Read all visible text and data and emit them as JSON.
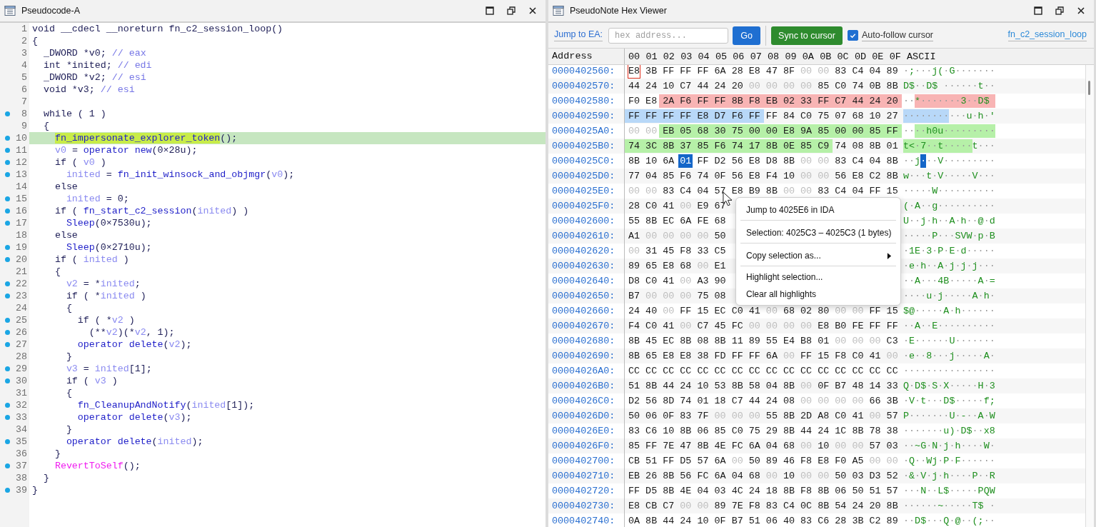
{
  "code_pane": {
    "title": "Pseudocode-A",
    "lines": [
      {
        "number": "1",
        "marked": false,
        "current": false,
        "tokens": [
          {
            "text": "void __cdecl __noreturn fn_c2_session_loop()",
            "kind": "p"
          }
        ]
      },
      {
        "number": "2",
        "marked": false,
        "current": false,
        "tokens": [
          {
            "text": "{",
            "kind": "p"
          }
        ]
      },
      {
        "number": "3",
        "marked": false,
        "current": false,
        "tokens": [
          {
            "text": "  _DWORD *v0; ",
            "kind": "p"
          },
          {
            "text": "// eax",
            "kind": "c"
          }
        ]
      },
      {
        "number": "4",
        "marked": false,
        "current": false,
        "tokens": [
          {
            "text": "  int *inited; ",
            "kind": "p"
          },
          {
            "text": "// edi",
            "kind": "c"
          }
        ]
      },
      {
        "number": "5",
        "marked": false,
        "current": false,
        "tokens": [
          {
            "text": "  _DWORD *v2; ",
            "kind": "p"
          },
          {
            "text": "// esi",
            "kind": "c"
          }
        ]
      },
      {
        "number": "6",
        "marked": false,
        "current": false,
        "tokens": [
          {
            "text": "  void *v3; ",
            "kind": "p"
          },
          {
            "text": "// esi",
            "kind": "c"
          }
        ]
      },
      {
        "number": "7",
        "marked": false,
        "current": false
      },
      {
        "number": "8",
        "marked": true,
        "current": false,
        "tokens": [
          {
            "text": "  while ( 1 )",
            "kind": "p"
          }
        ]
      },
      {
        "number": "9",
        "marked": false,
        "current": false,
        "tokens": [
          {
            "text": "  {",
            "kind": "p"
          }
        ]
      },
      {
        "number": "10",
        "marked": true,
        "current": true,
        "tokens": [
          {
            "text": "    fn_impersonate_explorer_token",
            "kind": "h"
          },
          {
            "text": "();",
            "kind": "p"
          }
        ]
      },
      {
        "number": "11",
        "marked": true,
        "current": false,
        "tokens": [
          {
            "text": "    v0",
            "kind": "v"
          },
          {
            "text": " = ",
            "kind": "p"
          },
          {
            "text": "operator new",
            "kind": "f"
          },
          {
            "text": "(0×28u);",
            "kind": "p"
          }
        ]
      },
      {
        "number": "12",
        "marked": true,
        "current": false,
        "tokens": [
          {
            "text": "    if ( ",
            "kind": "p"
          },
          {
            "text": "v0",
            "kind": "v"
          },
          {
            "text": " )",
            "kind": "p"
          }
        ]
      },
      {
        "number": "13",
        "marked": true,
        "current": false,
        "tokens": [
          {
            "text": "      inited",
            "kind": "v"
          },
          {
            "text": " = ",
            "kind": "p"
          },
          {
            "text": "fn_init_winsock_and_objmgr",
            "kind": "f"
          },
          {
            "text": "(",
            "kind": "p"
          },
          {
            "text": "v0",
            "kind": "v"
          },
          {
            "text": ");",
            "kind": "p"
          }
        ]
      },
      {
        "number": "14",
        "marked": false,
        "current": false,
        "tokens": [
          {
            "text": "    else",
            "kind": "p"
          }
        ]
      },
      {
        "number": "15",
        "marked": true,
        "current": false,
        "tokens": [
          {
            "text": "      inited",
            "kind": "v"
          },
          {
            "text": " = 0;",
            "kind": "p"
          }
        ]
      },
      {
        "number": "16",
        "marked": true,
        "current": false,
        "tokens": [
          {
            "text": "    if ( ",
            "kind": "p"
          },
          {
            "text": "fn_start_c2_session",
            "kind": "f"
          },
          {
            "text": "(",
            "kind": "p"
          },
          {
            "text": "inited",
            "kind": "v"
          },
          {
            "text": ") )",
            "kind": "p"
          }
        ]
      },
      {
        "number": "17",
        "marked": true,
        "current": false,
        "tokens": [
          {
            "text": "      Sleep",
            "kind": "f"
          },
          {
            "text": "(0×7530u);",
            "kind": "p"
          }
        ]
      },
      {
        "number": "18",
        "marked": false,
        "current": false,
        "tokens": [
          {
            "text": "    else",
            "kind": "p"
          }
        ]
      },
      {
        "number": "19",
        "marked": true,
        "current": false,
        "tokens": [
          {
            "text": "      Sleep",
            "kind": "f"
          },
          {
            "text": "(0×2710u);",
            "kind": "p"
          }
        ]
      },
      {
        "number": "20",
        "marked": true,
        "current": false,
        "tokens": [
          {
            "text": "    if ( ",
            "kind": "p"
          },
          {
            "text": "inited",
            "kind": "v"
          },
          {
            "text": " )",
            "kind": "p"
          }
        ]
      },
      {
        "number": "21",
        "marked": false,
        "current": false,
        "tokens": [
          {
            "text": "    {",
            "kind": "p"
          }
        ]
      },
      {
        "number": "22",
        "marked": true,
        "current": false,
        "tokens": [
          {
            "text": "      v2",
            "kind": "v"
          },
          {
            "text": " = *",
            "kind": "p"
          },
          {
            "text": "inited",
            "kind": "v"
          },
          {
            "text": ";",
            "kind": "p"
          }
        ]
      },
      {
        "number": "23",
        "marked": true,
        "current": false,
        "tokens": [
          {
            "text": "      if ( *",
            "kind": "p"
          },
          {
            "text": "inited",
            "kind": "v"
          },
          {
            "text": " )",
            "kind": "p"
          }
        ]
      },
      {
        "number": "24",
        "marked": false,
        "current": false,
        "tokens": [
          {
            "text": "      {",
            "kind": "p"
          }
        ]
      },
      {
        "number": "25",
        "marked": true,
        "current": false,
        "tokens": [
          {
            "text": "        if ( *",
            "kind": "p"
          },
          {
            "text": "v2",
            "kind": "v"
          },
          {
            "text": " )",
            "kind": "p"
          }
        ]
      },
      {
        "number": "26",
        "marked": true,
        "current": false,
        "tokens": [
          {
            "text": "          (**",
            "kind": "p"
          },
          {
            "text": "v2",
            "kind": "v"
          },
          {
            "text": ")(*",
            "kind": "p"
          },
          {
            "text": "v2",
            "kind": "v"
          },
          {
            "text": ", 1);",
            "kind": "p"
          }
        ]
      },
      {
        "number": "27",
        "marked": true,
        "current": false,
        "tokens": [
          {
            "text": "        operator delete",
            "kind": "f"
          },
          {
            "text": "(",
            "kind": "p"
          },
          {
            "text": "v2",
            "kind": "v"
          },
          {
            "text": ");",
            "kind": "p"
          }
        ]
      },
      {
        "number": "28",
        "marked": false,
        "current": false,
        "tokens": [
          {
            "text": "      }",
            "kind": "p"
          }
        ]
      },
      {
        "number": "29",
        "marked": true,
        "current": false,
        "tokens": [
          {
            "text": "      v3",
            "kind": "v"
          },
          {
            "text": " = ",
            "kind": "p"
          },
          {
            "text": "inited",
            "kind": "v"
          },
          {
            "text": "[1];",
            "kind": "p"
          }
        ]
      },
      {
        "number": "30",
        "marked": true,
        "current": false,
        "tokens": [
          {
            "text": "      if ( ",
            "kind": "p"
          },
          {
            "text": "v3",
            "kind": "v"
          },
          {
            "text": " )",
            "kind": "p"
          }
        ]
      },
      {
        "number": "31",
        "marked": false,
        "current": false,
        "tokens": [
          {
            "text": "      {",
            "kind": "p"
          }
        ]
      },
      {
        "number": "32",
        "marked": true,
        "current": false,
        "tokens": [
          {
            "text": "        fn_CleanupAndNotify",
            "kind": "f"
          },
          {
            "text": "(",
            "kind": "p"
          },
          {
            "text": "inited",
            "kind": "v"
          },
          {
            "text": "[1]);",
            "kind": "p"
          }
        ]
      },
      {
        "number": "33",
        "marked": true,
        "current": false,
        "tokens": [
          {
            "text": "        operator delete",
            "kind": "f"
          },
          {
            "text": "(",
            "kind": "p"
          },
          {
            "text": "v3",
            "kind": "v"
          },
          {
            "text": ");",
            "kind": "p"
          }
        ]
      },
      {
        "number": "34",
        "marked": false,
        "current": false,
        "tokens": [
          {
            "text": "      }",
            "kind": "p"
          }
        ]
      },
      {
        "number": "35",
        "marked": true,
        "current": false,
        "tokens": [
          {
            "text": "      operator delete",
            "kind": "f"
          },
          {
            "text": "(",
            "kind": "p"
          },
          {
            "text": "inited",
            "kind": "v"
          },
          {
            "text": ");",
            "kind": "p"
          }
        ]
      },
      {
        "number": "36",
        "marked": false,
        "current": false,
        "tokens": [
          {
            "text": "    }",
            "kind": "p"
          }
        ]
      },
      {
        "number": "37",
        "marked": true,
        "current": false,
        "tokens": [
          {
            "text": "    RevertToSelf",
            "kind": "i"
          },
          {
            "text": "();",
            "kind": "p"
          }
        ]
      },
      {
        "number": "38",
        "marked": false,
        "current": false,
        "tokens": [
          {
            "text": "  }",
            "kind": "p"
          }
        ]
      },
      {
        "number": "39",
        "marked": true,
        "current": false,
        "tokens": [
          {
            "text": "}",
            "kind": "p"
          }
        ]
      }
    ]
  },
  "hex_pane": {
    "title": "PseudoNote Hex Viewer",
    "toolbar": {
      "jump_label": "Jump to EA:",
      "address_field": {
        "placeholder": "hex address..."
      },
      "go_button": "Go",
      "sync_button": "Sync to cursor",
      "auto_follow": {
        "label": "Auto-follow cursor",
        "checked": true
      },
      "function_link": "fn_c2_session_loop"
    },
    "table": {
      "address_header": "Address",
      "columns": [
        "00",
        "01",
        "02",
        "03",
        "04",
        "05",
        "06",
        "07",
        "08",
        "09",
        "0A",
        "0B",
        "0C",
        "0D",
        "0E",
        "0F"
      ],
      "ascii_header": "ASCII",
      "rows": [
        {
          "address": "0000402560:",
          "hex": [
            {
              "text": "E8",
              "kind": "cursor"
            },
            {
              "text": "3B FF FF FF 6A 28 E8 47 8F",
              "kind": "plain"
            },
            {
              "text": "00 00",
              "kind": "null"
            },
            {
              "text": "83 C4 04 89",
              "kind": "plain"
            }
          ],
          "ascii": [
            {
              "text": "·;···j(·G·······",
              "kind": "plain"
            }
          ]
        },
        {
          "address": "0000402570:",
          "hex": [
            {
              "text": "44 24 10 C7 44 24 20",
              "kind": "plain"
            },
            {
              "text": "00 00 00 00",
              "kind": "null"
            },
            {
              "text": "85 C0 74 0B 8B",
              "kind": "plain"
            }
          ],
          "ascii": [
            {
              "text": "D$··D$ ······t··",
              "kind": "plain"
            }
          ]
        },
        {
          "address": "0000402580:",
          "hex": [
            {
              "text": "F0 E8",
              "kind": "plain"
            },
            {
              "text": "2A F6 FF FF 8B F8 EB 02 33 FF C7 44 24 20",
              "kind": "mark",
              "color": "#f8b4b4"
            }
          ],
          "ascii": [
            {
              "text": "··",
              "kind": "plain"
            },
            {
              "text": "*·······3··D$ ",
              "kind": "mark",
              "color": "#f8b4b4"
            }
          ]
        },
        {
          "address": "0000402590:",
          "hex": [
            {
              "text": "FF FF FF FF E8 D7 F6 FF",
              "kind": "mark",
              "color": "#b8d8f8"
            },
            {
              "text": "FF 84 C0 75 07 68 10 27",
              "kind": "plain"
            }
          ],
          "ascii": [
            {
              "text": "········",
              "kind": "mark",
              "color": "#b8d8f8"
            },
            {
              "text": "···u·h·'",
              "kind": "plain"
            }
          ]
        },
        {
          "address": "00004025A0:",
          "hex": [
            {
              "text": "00 00",
              "kind": "null"
            },
            {
              "text": "EB 05 68 30 75 00 00 E8 9A 85 00 00 85 FF",
              "kind": "mark",
              "color": "#b6f0a8"
            }
          ],
          "ascii": [
            {
              "text": "··",
              "kind": "plain"
            },
            {
              "text": "··h0u·········",
              "kind": "mark",
              "color": "#b6f0a8"
            }
          ]
        },
        {
          "address": "00004025B0:",
          "hex": [
            {
              "text": "74 3C 8B 37 85 F6 74 17 8B 0E 85 C9",
              "kind": "mark",
              "color": "#b6f0a8"
            },
            {
              "text": "74 08 8B 01",
              "kind": "plain"
            }
          ],
          "ascii": [
            {
              "text": "t<·7··t·····",
              "kind": "mark",
              "color": "#b6f0a8"
            },
            {
              "text": "t···",
              "kind": "plain"
            }
          ]
        },
        {
          "address": "00004025C0:",
          "hex": [
            {
              "text": "8B 10 6A",
              "kind": "plain"
            },
            {
              "text": "01",
              "kind": "selected"
            },
            {
              "text": "FF D2 56 E8 D8 8B",
              "kind": "plain"
            },
            {
              "text": "00 00",
              "kind": "null"
            },
            {
              "text": "83 C4 04 8B",
              "kind": "plain"
            }
          ],
          "ascii": [
            {
              "text": "··j",
              "kind": "plain"
            },
            {
              "text": "·",
              "kind": "selected"
            },
            {
              "text": "··V·········",
              "kind": "plain"
            }
          ]
        },
        {
          "address": "00004025D0:",
          "hex": [
            {
              "text": "77 04 85 F6 74 0F 56 E8 F4 10",
              "kind": "plain"
            },
            {
              "text": "00 00",
              "kind": "null"
            },
            {
              "text": "56 E8 C2 8B",
              "kind": "plain"
            }
          ],
          "ascii": [
            {
              "text": "w···t·V·····V···",
              "kind": "plain"
            }
          ]
        },
        {
          "address": "00004025E0:",
          "hex": [
            {
              "text": "00 00",
              "kind": "null"
            },
            {
              "text": "83 C4 04 57 E8 B9 8B",
              "kind": "plain"
            },
            {
              "text": "00 00",
              "kind": "null"
            },
            {
              "text": "83 C4 04 FF 15",
              "kind": "plain"
            }
          ],
          "ascii": [
            {
              "text": "·····W··········",
              "kind": "plain"
            }
          ]
        },
        {
          "address": "00004025F0:",
          "hex": [
            {
              "text": "28 C0 41",
              "kind": "plain"
            },
            {
              "text": "00",
              "kind": "null"
            },
            {
              "text": "E9 67",
              "kind": "plain"
            }
          ],
          "ascii": [
            {
              "text": "(·A··g··········",
              "kind": "plain"
            }
          ]
        },
        {
          "address": "0000402600:",
          "hex": [
            {
              "text": "55 8B EC 6A FE 68",
              "kind": "plain"
            }
          ],
          "ascii": [
            {
              "text": "U··j·h··A·h··@·d",
              "kind": "plain"
            }
          ]
        },
        {
          "address": "0000402610:",
          "hex": [
            {
              "text": "A1",
              "kind": "plain"
            },
            {
              "text": "00 00 00 00",
              "kind": "null"
            },
            {
              "text": "50",
              "kind": "plain"
            }
          ],
          "ascii": [
            {
              "text": "·····P···SVW·p·B",
              "kind": "plain"
            }
          ]
        },
        {
          "address": "0000402620:",
          "hex": [
            {
              "text": "00",
              "kind": "null"
            },
            {
              "text": "31 45 F8 33 C5",
              "kind": "plain"
            }
          ],
          "ascii": [
            {
              "text": "·1E·3·P·E·d·····",
              "kind": "plain"
            }
          ]
        },
        {
          "address": "0000402630:",
          "hex": [
            {
              "text": "89 65 E8 68",
              "kind": "plain"
            },
            {
              "text": "00",
              "kind": "null"
            },
            {
              "text": "E1",
              "kind": "plain"
            }
          ],
          "ascii": [
            {
              "text": "·e·h··A·j·j·j···",
              "kind": "plain"
            }
          ]
        },
        {
          "address": "0000402640:",
          "hex": [
            {
              "text": "D8 C0 41",
              "kind": "plain"
            },
            {
              "text": "00",
              "kind": "null"
            },
            {
              "text": "A3 90",
              "kind": "plain"
            }
          ],
          "ascii": [
            {
              "text": "··A···4B·····A·=",
              "kind": "plain"
            }
          ]
        },
        {
          "address": "0000402650:",
          "hex": [
            {
              "text": "B7",
              "kind": "plain"
            },
            {
              "text": "00 00 00",
              "kind": "null"
            },
            {
              "text": "75 08",
              "kind": "plain"
            }
          ],
          "ascii": [
            {
              "text": "····u·j·····A·h·",
              "kind": "plain"
            }
          ]
        },
        {
          "address": "0000402660:",
          "hex": [
            {
              "text": "24 40",
              "kind": "plain"
            },
            {
              "text": "00",
              "kind": "null"
            },
            {
              "text": "FF 15 EC C0 41",
              "kind": "plain"
            },
            {
              "text": "00",
              "kind": "null"
            },
            {
              "text": "68 02 80",
              "kind": "plain"
            },
            {
              "text": "00 00",
              "kind": "null"
            },
            {
              "text": "FF 15",
              "kind": "plain"
            }
          ],
          "ascii": [
            {
              "text": "$@·····A·h······",
              "kind": "plain"
            }
          ]
        },
        {
          "address": "0000402670:",
          "hex": [
            {
              "text": "F4 C0 41",
              "kind": "plain"
            },
            {
              "text": "00",
              "kind": "null"
            },
            {
              "text": "C7 45 FC",
              "kind": "plain"
            },
            {
              "text": "00 00 00 00",
              "kind": "null"
            },
            {
              "text": "E8 B0 FE FF FF",
              "kind": "plain"
            }
          ],
          "ascii": [
            {
              "text": "··A··E··········",
              "kind": "plain"
            }
          ]
        },
        {
          "address": "0000402680:",
          "hex": [
            {
              "text": "8B 45 EC 8B 08 8B 11 89 55 E4 B8 01",
              "kind": "plain"
            },
            {
              "text": "00 00 00",
              "kind": "null"
            },
            {
              "text": "C3",
              "kind": "plain"
            }
          ],
          "ascii": [
            {
              "text": "·E······U·······",
              "kind": "plain"
            }
          ]
        },
        {
          "address": "0000402690:",
          "hex": [
            {
              "text": "8B 65 E8 E8 38 FD FF FF 6A",
              "kind": "plain"
            },
            {
              "text": "00",
              "kind": "null"
            },
            {
              "text": "FF 15 F8 C0 41",
              "kind": "plain"
            },
            {
              "text": "00",
              "kind": "null"
            }
          ],
          "ascii": [
            {
              "text": "·e··8···j·····A·",
              "kind": "plain"
            }
          ]
        },
        {
          "address": "00004026A0:",
          "hex": [
            {
              "text": "CC CC CC CC CC CC CC CC CC CC CC CC CC CC CC CC",
              "kind": "plain"
            }
          ],
          "ascii": [
            {
              "text": "················",
              "kind": "plain"
            }
          ]
        },
        {
          "address": "00004026B0:",
          "hex": [
            {
              "text": "51 8B 44 24 10 53 8B 58 04 8B",
              "kind": "plain"
            },
            {
              "text": "00",
              "kind": "null"
            },
            {
              "text": "0F B7 48 14 33",
              "kind": "plain"
            }
          ],
          "ascii": [
            {
              "text": "Q·D$·S·X·····H·3",
              "kind": "plain"
            }
          ]
        },
        {
          "address": "00004026C0:",
          "hex": [
            {
              "text": "D2 56 8D 74 01 18 C7 44 24 08",
              "kind": "plain"
            },
            {
              "text": "00 00 00 00",
              "kind": "null"
            },
            {
              "text": "66 3B",
              "kind": "plain"
            }
          ],
          "ascii": [
            {
              "text": "·V·t···D$·····f;",
              "kind": "plain"
            }
          ]
        },
        {
          "address": "00004026D0:",
          "hex": [
            {
              "text": "50 06 0F 83 7F",
              "kind": "plain"
            },
            {
              "text": "00 00 00",
              "kind": "null"
            },
            {
              "text": "55 8B 2D A8 C0 41",
              "kind": "plain"
            },
            {
              "text": "00",
              "kind": "null"
            },
            {
              "text": "57",
              "kind": "plain"
            }
          ],
          "ascii": [
            {
              "text": "P·······U·-··A·W",
              "kind": "plain"
            }
          ]
        },
        {
          "address": "00004026E0:",
          "hex": [
            {
              "text": "83 C6 10 8B 06 85 C0 75 29 8B 44 24 1C 8B 78 38",
              "kind": "plain"
            }
          ],
          "ascii": [
            {
              "text": "·······u)·D$··x8",
              "kind": "plain"
            }
          ]
        },
        {
          "address": "00004026F0:",
          "hex": [
            {
              "text": "85 FF 7E 47 8B 4E FC 6A 04 68",
              "kind": "plain"
            },
            {
              "text": "00",
              "kind": "null"
            },
            {
              "text": "10",
              "kind": "plain"
            },
            {
              "text": "00 00",
              "kind": "null"
            },
            {
              "text": "57 03",
              "kind": "plain"
            }
          ],
          "ascii": [
            {
              "text": "··~G·N·j·h····W·",
              "kind": "plain"
            }
          ]
        },
        {
          "address": "0000402700:",
          "hex": [
            {
              "text": "CB 51 FF D5 57 6A",
              "kind": "plain"
            },
            {
              "text": "00",
              "kind": "null"
            },
            {
              "text": "50 89 46 F8 E8 F0 A5",
              "kind": "plain"
            },
            {
              "text": "00 00",
              "kind": "null"
            }
          ],
          "ascii": [
            {
              "text": "·Q··Wj·P·F······",
              "kind": "plain"
            }
          ]
        },
        {
          "address": "0000402710:",
          "hex": [
            {
              "text": "EB 26 8B 56 FC 6A 04 68",
              "kind": "plain"
            },
            {
              "text": "00",
              "kind": "null"
            },
            {
              "text": "10",
              "kind": "plain"
            },
            {
              "text": "00 00",
              "kind": "null"
            },
            {
              "text": "50 03 D3 52",
              "kind": "plain"
            }
          ],
          "ascii": [
            {
              "text": "·&·V·j·h····P··R",
              "kind": "plain"
            }
          ]
        },
        {
          "address": "0000402720:",
          "hex": [
            {
              "text": "FF D5 8B 4E 04 03 4C 24 18 8B F8 8B 06 50 51 57",
              "kind": "plain"
            }
          ],
          "ascii": [
            {
              "text": "···N··L$·····PQW",
              "kind": "plain"
            }
          ]
        },
        {
          "address": "0000402730:",
          "hex": [
            {
              "text": "E8 CB C7",
              "kind": "plain"
            },
            {
              "text": "00 00",
              "kind": "null"
            },
            {
              "text": "89 7E F8 83 C4 0C 8B 54 24 20 8B",
              "kind": "plain"
            }
          ],
          "ascii": [
            {
              "text": "······~·····T$ ·",
              "kind": "plain"
            }
          ]
        },
        {
          "address": "0000402740:",
          "hex": [
            {
              "text": "0A 8B 44 24 10 0F B7 51 06 40 83 C6 28 3B C2 89",
              "kind": "plain"
            }
          ],
          "ascii": [
            {
              "text": "··D$···Q·@··(;··",
              "kind": "plain"
            }
          ]
        }
      ]
    },
    "context_menu": {
      "items": [
        {
          "label": "Jump to 4025E6 in IDA",
          "submenu": false,
          "separator_after": true
        },
        {
          "label": "Selection: 4025C3 – 4025C3  (1 bytes)",
          "submenu": false,
          "separator_after": true
        },
        {
          "label": "Copy selection as...",
          "submenu": true,
          "separator_after": true
        },
        {
          "label": "Highlight selection...",
          "submenu": false,
          "separator_after": false
        },
        {
          "label": "Clear all highlights",
          "submenu": false,
          "separator_after": false
        }
      ]
    }
  }
}
